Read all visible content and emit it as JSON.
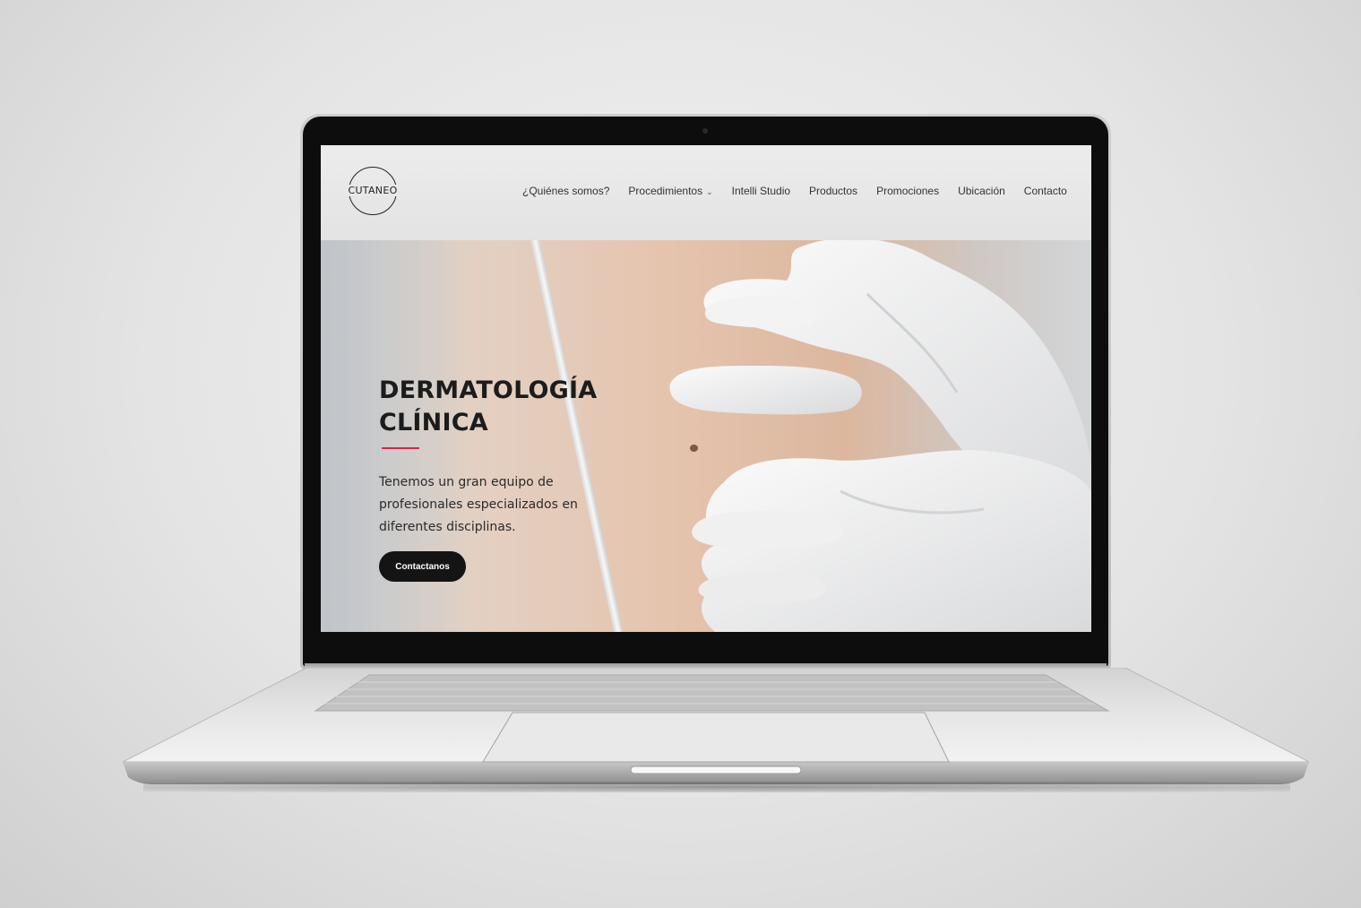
{
  "site": {
    "logo_text": "CUTANEO",
    "nav": [
      {
        "label": "¿Quiénes somos?",
        "has_dropdown": false
      },
      {
        "label": "Procedimientos",
        "has_dropdown": true
      },
      {
        "label": "Intelli Studio",
        "has_dropdown": false
      },
      {
        "label": "Productos",
        "has_dropdown": false
      },
      {
        "label": "Promociones",
        "has_dropdown": false
      },
      {
        "label": "Ubicación",
        "has_dropdown": false
      },
      {
        "label": "Contacto",
        "has_dropdown": false
      }
    ]
  },
  "hero": {
    "title_line1": "DERMATOLOGÍA",
    "title_line2": "CLÍNICA",
    "text": "Tenemos un gran equipo de profesionales especializados en diferentes disciplinas.",
    "cta_label": "Contactanos"
  },
  "colors": {
    "accent": "#d4264b",
    "cta_background": "#141414",
    "whatsapp": "#2fb84a"
  },
  "icons": {
    "whatsapp": "whatsapp-icon",
    "dropdown": "chevron-down-icon"
  }
}
